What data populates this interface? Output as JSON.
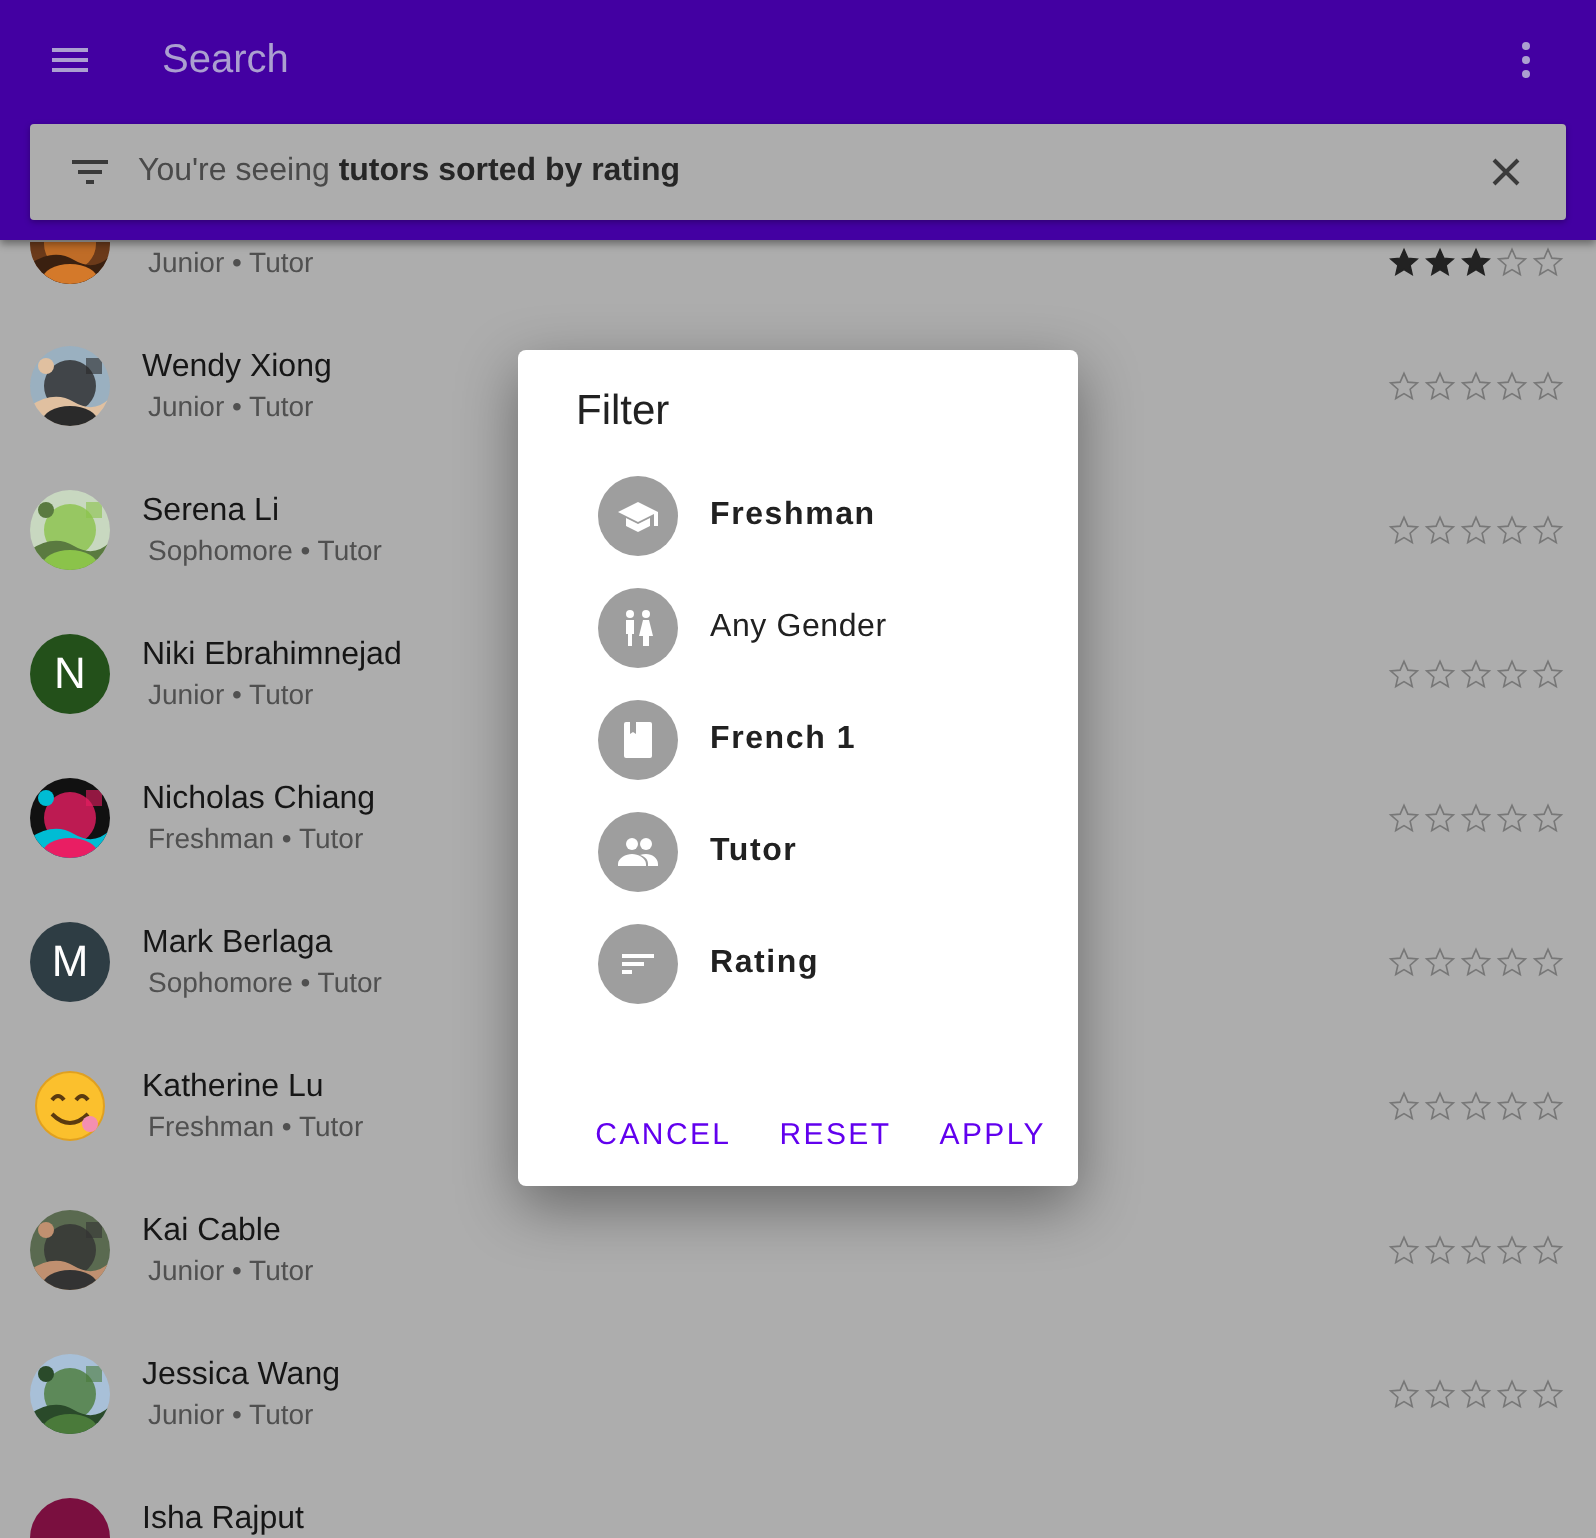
{
  "app_bar": {
    "title": "Search"
  },
  "search_bar": {
    "text": "You're seeing **tutors sorted by rating**"
  },
  "tutors": [
    {
      "subtitle": "Junior • Tutor",
      "stars": 3
    },
    {
      "name": "Wendy Xiong",
      "subtitle": "Junior • Tutor",
      "stars": 0
    },
    {
      "name": "Serena Li",
      "subtitle": "Sophomore • Tutor",
      "stars": 0
    },
    {
      "name": "Niki Ebrahimnejad",
      "subtitle": "Junior • Tutor",
      "stars": 0,
      "avatar": {
        "kind": "letter",
        "letter": "N",
        "color": "#23501a"
      }
    },
    {
      "name": "Nicholas Chiang",
      "subtitle": "Freshman • Tutor",
      "stars": 0
    },
    {
      "name": "Mark Berlaga",
      "subtitle": "Sophomore • Tutor",
      "stars": 0,
      "avatar": {
        "kind": "letter",
        "letter": "M",
        "color": "#2e3d44"
      }
    },
    {
      "name": "Katherine Lu",
      "subtitle": "Freshman • Tutor",
      "stars": 0,
      "avatar": {
        "kind": "emoji"
      }
    },
    {
      "name": "Kai Cable",
      "subtitle": "Junior • Tutor",
      "stars": 0
    },
    {
      "name": "Jessica Wang",
      "subtitle": "Junior • Tutor",
      "stars": 0
    },
    {
      "name": "Isha Rajput",
      "avatar": {
        "kind": "letter",
        "color": "#7a0f3f"
      }
    }
  ],
  "dialog": {
    "title": "Filter",
    "items": [
      {
        "kind": "year",
        "label": "Freshman",
        "active": true
      },
      {
        "kind": "gender",
        "label": "Any Gender",
        "active": false
      },
      {
        "kind": "course",
        "label": "French 1",
        "active": true
      },
      {
        "kind": "role",
        "label": "Tutor",
        "active": true
      },
      {
        "kind": "sort",
        "label": "Rating",
        "active": true
      }
    ],
    "buttons": [
      "CANCEL",
      "RESET",
      "APPLY"
    ]
  }
}
